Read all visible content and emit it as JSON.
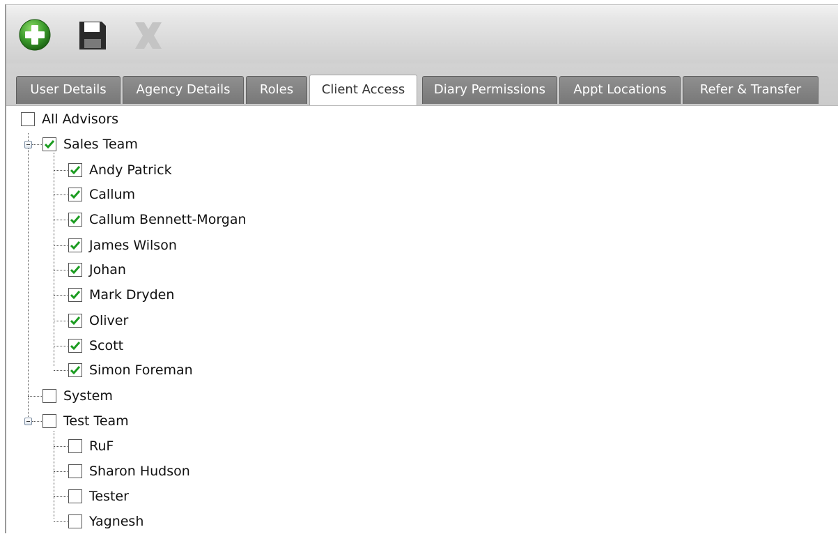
{
  "toolbar": {
    "add_icon": "add-circle-icon",
    "save_icon": "save-disk-icon",
    "delete_icon": "delete-x-icon",
    "colors": {
      "add": "#3a9a2a",
      "save": "#2b2b2b",
      "delete_disabled": "#c4c4c4"
    }
  },
  "tabs": [
    {
      "label": "User Details",
      "active": false
    },
    {
      "label": "Agency Details",
      "active": false
    },
    {
      "label": "Roles",
      "active": false
    },
    {
      "label": "Client Access",
      "active": true
    },
    {
      "label": "Diary Permissions",
      "active": false
    },
    {
      "label": "Appt Locations",
      "active": false
    },
    {
      "label": "Refer & Transfer",
      "active": false
    }
  ],
  "tree": {
    "all_advisors": {
      "label": "All Advisors",
      "checked": false
    },
    "groups": [
      {
        "label": "Sales Team",
        "checked": true,
        "expanded": true,
        "children": [
          {
            "label": "Andy Patrick",
            "checked": true
          },
          {
            "label": "Callum",
            "checked": true
          },
          {
            "label": "Callum Bennett-Morgan",
            "checked": true
          },
          {
            "label": "James Wilson",
            "checked": true
          },
          {
            "label": "Johan",
            "checked": true
          },
          {
            "label": "Mark Dryden",
            "checked": true
          },
          {
            "label": "Oliver",
            "checked": true
          },
          {
            "label": "Scott",
            "checked": true
          },
          {
            "label": "Simon Foreman",
            "checked": true
          }
        ]
      },
      {
        "label": "System",
        "checked": false,
        "expanded": false,
        "children": []
      },
      {
        "label": "Test Team",
        "checked": false,
        "expanded": true,
        "children": [
          {
            "label": "RuF",
            "checked": false
          },
          {
            "label": "Sharon Hudson",
            "checked": false
          },
          {
            "label": "Tester",
            "checked": false
          },
          {
            "label": "Yagnesh",
            "checked": false
          }
        ]
      }
    ]
  }
}
